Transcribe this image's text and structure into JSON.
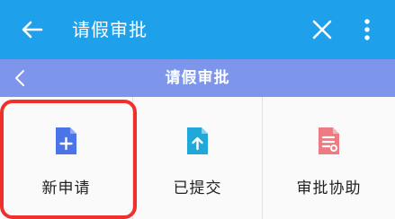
{
  "appbar": {
    "title": "请假审批",
    "back_icon": "arrow-left-icon",
    "close_icon": "close-icon",
    "more_icon": "more-vertical-icon",
    "background": "#1fa0ea"
  },
  "subbar": {
    "title": "请假审批",
    "back_icon": "chevron-left-icon",
    "background": "#7d95ea"
  },
  "tiles": [
    {
      "label": "新申请",
      "icon": "new-document-icon",
      "icon_color": "#4a74e8"
    },
    {
      "label": "已提交",
      "icon": "upload-document-icon",
      "icon_color": "#1fa8d8"
    },
    {
      "label": "审批协助",
      "icon": "approval-document-icon",
      "icon_color": "#ee7a82"
    }
  ],
  "highlight_color": "#f0302d"
}
